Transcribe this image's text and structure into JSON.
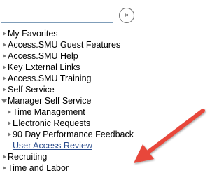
{
  "search": {
    "value": "",
    "placeholder": "",
    "go_glyph": "»"
  },
  "menu": {
    "items": [
      {
        "label": "My Favorites",
        "state": "collapsed"
      },
      {
        "label": "Access.SMU Guest Features",
        "state": "collapsed"
      },
      {
        "label": "Access.SMU Help",
        "state": "collapsed"
      },
      {
        "label": "Key External Links",
        "state": "collapsed"
      },
      {
        "label": "Access.SMU Training",
        "state": "collapsed"
      },
      {
        "label": "Self Service",
        "state": "collapsed"
      },
      {
        "label": "Manager Self Service",
        "state": "expanded",
        "children": [
          {
            "label": "Time Management",
            "state": "collapsed"
          },
          {
            "label": "Electronic Requests",
            "state": "collapsed"
          },
          {
            "label": "90 Day Performance Feedback",
            "state": "collapsed"
          },
          {
            "label": "User Access Review",
            "state": "link"
          }
        ]
      },
      {
        "label": "Recruiting",
        "state": "collapsed"
      },
      {
        "label": "Time and Labor",
        "state": "collapsed"
      }
    ]
  },
  "annotation": {
    "arrow_color": "#e8463a",
    "target": "User Access Review"
  }
}
